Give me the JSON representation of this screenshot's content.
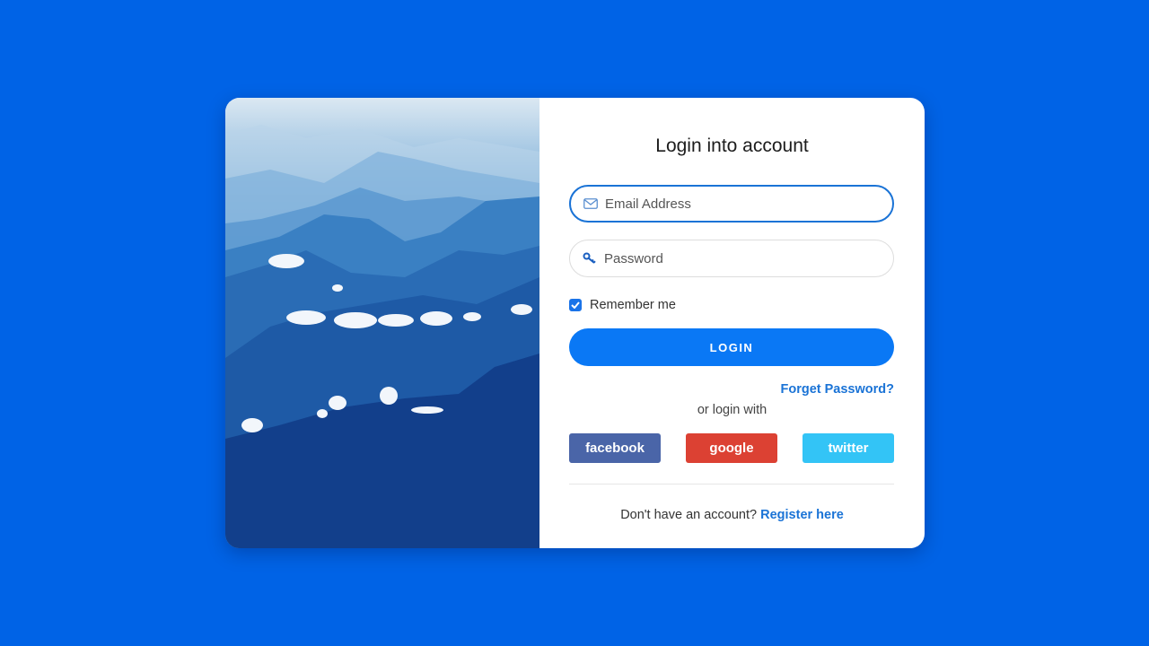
{
  "form": {
    "title": "Login into account",
    "email": {
      "placeholder": "Email Address",
      "value": "",
      "icon": "envelope-icon"
    },
    "password": {
      "placeholder": "Password",
      "value": "",
      "icon": "key-icon"
    },
    "remember": {
      "label": "Remember me",
      "checked": true
    },
    "login_label": "LOGIN",
    "forgot_label": "Forget Password?",
    "or_label": "or login with",
    "social": [
      {
        "label": "facebook",
        "color": "#4a65a8"
      },
      {
        "label": "google",
        "color": "#dc4133"
      },
      {
        "label": "twitter",
        "color": "#33c4f6"
      }
    ],
    "register_prompt": "Don't have an account?",
    "register_link": "Register here"
  },
  "colors": {
    "background": "#0063e6",
    "accent": "#0a78f5",
    "link": "#1a73d6"
  }
}
